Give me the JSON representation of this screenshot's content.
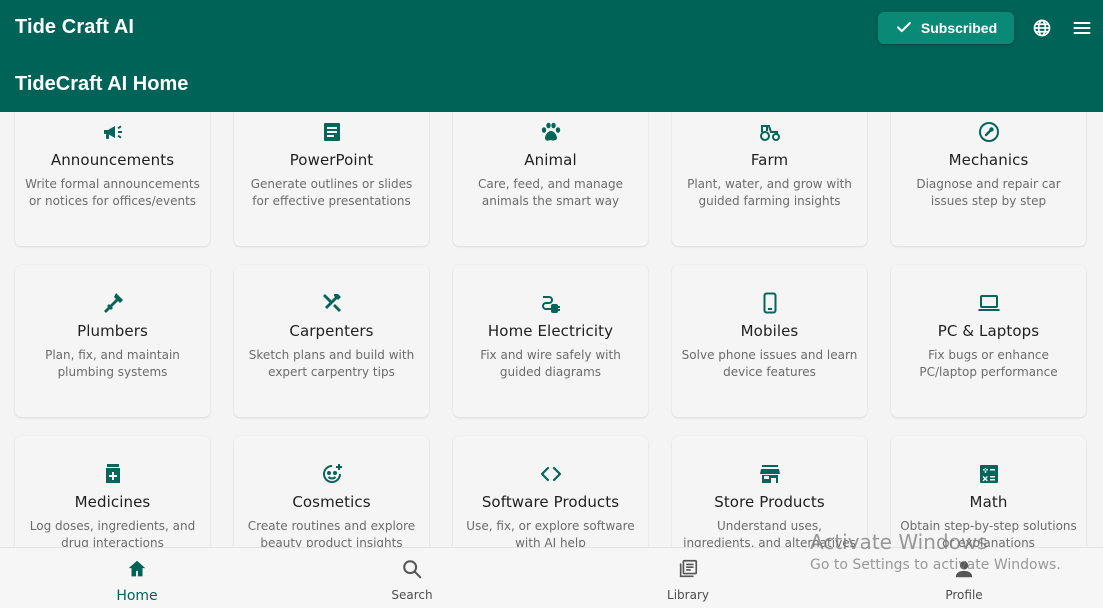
{
  "app": {
    "name": "Tide Craft AI",
    "page_title": "TideCraft AI Home"
  },
  "header": {
    "subscribed_label": "Subscribed",
    "icons": [
      "language-icon",
      "menu-icon"
    ]
  },
  "colors": {
    "primary": "#006358",
    "button": "#0a8a76",
    "icon": "#066459"
  },
  "cards": [
    {
      "icon": "megaphone-icon",
      "title": "Announcements",
      "desc": "Write formal announcements or notices for offices/events"
    },
    {
      "icon": "document-icon",
      "title": "PowerPoint",
      "desc": "Generate outlines or slides for effective presentations"
    },
    {
      "icon": "paw-icon",
      "title": "Animal",
      "desc": "Care, feed, and manage animals the smart way"
    },
    {
      "icon": "tractor-icon",
      "title": "Farm",
      "desc": "Plant, water, and grow with guided farming insights"
    },
    {
      "icon": "wrench-icon",
      "title": "Mechanics",
      "desc": "Diagnose and repair car issues step by step"
    },
    {
      "icon": "plumbing-icon",
      "title": "Plumbers",
      "desc": "Plan, fix, and maintain plumbing systems"
    },
    {
      "icon": "tools-icon",
      "title": "Carpenters",
      "desc": "Sketch plans and build with expert carpentry tips"
    },
    {
      "icon": "plug-icon",
      "title": "Home Electricity",
      "desc": "Fix and wire safely with guided diagrams"
    },
    {
      "icon": "phone-icon",
      "title": "Mobiles",
      "desc": "Solve phone issues and learn device features"
    },
    {
      "icon": "laptop-icon",
      "title": "PC & Laptops",
      "desc": "Fix bugs or enhance PC/laptop performance"
    },
    {
      "icon": "medicine-icon",
      "title": "Medicines",
      "desc": "Log doses, ingredients, and drug interactions"
    },
    {
      "icon": "face-icon",
      "title": "Cosmetics",
      "desc": "Create routines and explore beauty product insights"
    },
    {
      "icon": "code-icon",
      "title": "Software Products",
      "desc": "Use, fix, or explore software with AI help"
    },
    {
      "icon": "store-icon",
      "title": "Store Products",
      "desc": "Understand uses, ingredients, and alternatives"
    },
    {
      "icon": "calculator-icon",
      "title": "Math",
      "desc": "Obtain step-by-step solutions or explanations"
    }
  ],
  "nav": [
    {
      "icon": "home-icon",
      "label": "Home",
      "active": true
    },
    {
      "icon": "search-icon",
      "label": "Search",
      "active": false
    },
    {
      "icon": "library-icon",
      "label": "Library",
      "active": false
    },
    {
      "icon": "profile-icon",
      "label": "Profile",
      "active": false
    }
  ],
  "watermark": {
    "title": "Activate Windows",
    "subtitle": "Go to Settings to activate Windows."
  }
}
